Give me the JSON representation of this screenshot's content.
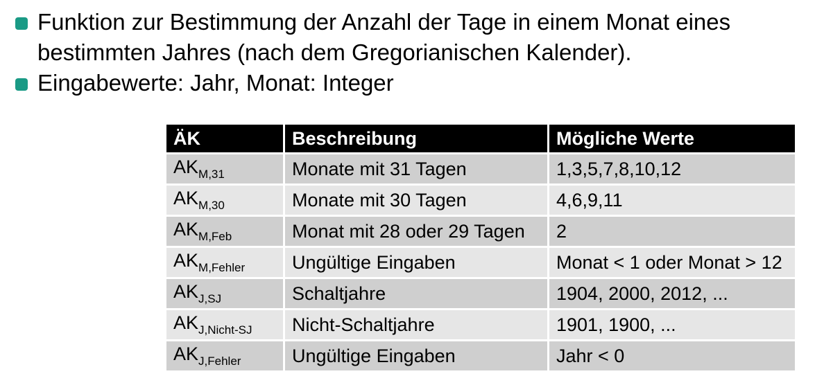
{
  "colors": {
    "bullet": "#1a9a85",
    "header_bg": "#000000",
    "header_text": "#ffffff",
    "row_dark": "#cfcfcf",
    "row_light": "#e6e6e6"
  },
  "bullets": [
    {
      "lines": [
        "Funktion zur Bestimmung der Anzahl der Tage in einem Monat eines",
        "bestimmten Jahres (nach dem Gregorianischen Kalender)."
      ]
    },
    {
      "lines": [
        "Eingabewerte: Jahr, Monat: Integer"
      ]
    }
  ],
  "table": {
    "headers": [
      "ÄK",
      "Beschreibung",
      "Mögliche Werte"
    ],
    "rows": [
      {
        "ak_main": "AK",
        "ak_sub": "M,31",
        "description": "Monate mit 31 Tagen",
        "values": "1,3,5,7,8,10,12"
      },
      {
        "ak_main": "AK",
        "ak_sub": "M,30",
        "description": "Monate mit 30 Tagen",
        "values": "4,6,9,11"
      },
      {
        "ak_main": "AK",
        "ak_sub": "M,Feb",
        "description": "Monat mit 28 oder 29 Tagen",
        "values": "2"
      },
      {
        "ak_main": "AK",
        "ak_sub": "M,Fehler",
        "description": "Ungültige Eingaben",
        "values": "Monat < 1 oder Monat > 12"
      },
      {
        "ak_main": "AK",
        "ak_sub": "J,SJ",
        "description": "Schaltjahre",
        "values": "1904, 2000, 2012, ..."
      },
      {
        "ak_main": "AK",
        "ak_sub": "J,Nicht-SJ",
        "description": "Nicht-Schaltjahre",
        "values": "1901, 1900, ..."
      },
      {
        "ak_main": "AK",
        "ak_sub": "J,Fehler",
        "description": "Ungültige Eingaben",
        "values": "Jahr < 0"
      }
    ]
  }
}
